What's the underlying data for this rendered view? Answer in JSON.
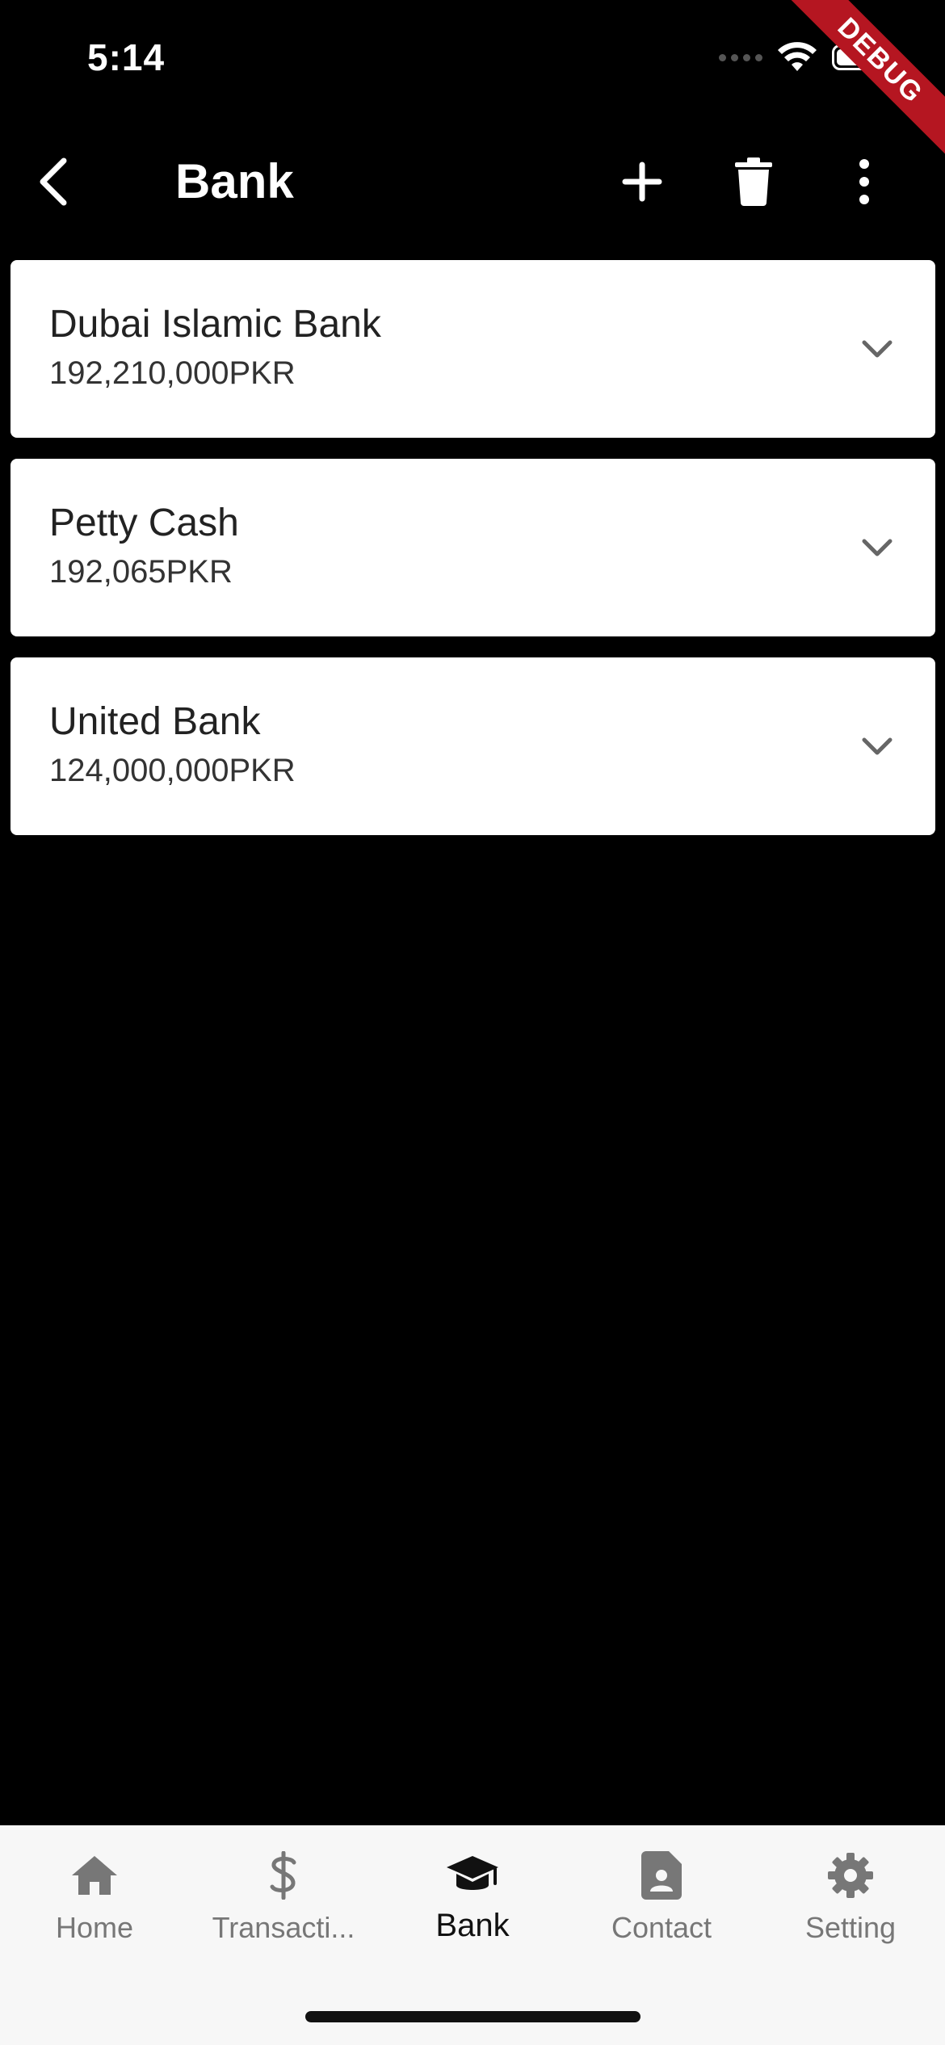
{
  "status_bar": {
    "time": "5:14"
  },
  "debug_banner": {
    "label": "DEBUG",
    "color": "#b51621"
  },
  "app_bar": {
    "title": "Bank",
    "back_icon": "chevron-left-icon",
    "add_icon": "plus-icon",
    "delete_icon": "trash-icon",
    "more_icon": "more-vertical-icon"
  },
  "accounts": [
    {
      "name": "Dubai Islamic Bank",
      "amount": "192,210,000PKR"
    },
    {
      "name": "Petty Cash",
      "amount": "192,065PKR"
    },
    {
      "name": "United Bank",
      "amount": "124,000,000PKR"
    }
  ],
  "bottom_nav": {
    "items": [
      {
        "label": "Home",
        "icon": "home-icon",
        "active": false
      },
      {
        "label": "Transacti...",
        "icon": "dollar-icon",
        "active": false
      },
      {
        "label": "Bank",
        "icon": "graduation-cap-icon",
        "active": true
      },
      {
        "label": "Contact",
        "icon": "contact-card-icon",
        "active": false
      },
      {
        "label": "Setting",
        "icon": "gear-icon",
        "active": false
      }
    ]
  },
  "colors": {
    "background": "#000000",
    "card": "#ffffff",
    "nav_background": "#f7f7f7",
    "nav_active": "#111111",
    "nav_inactive": "#777777"
  }
}
